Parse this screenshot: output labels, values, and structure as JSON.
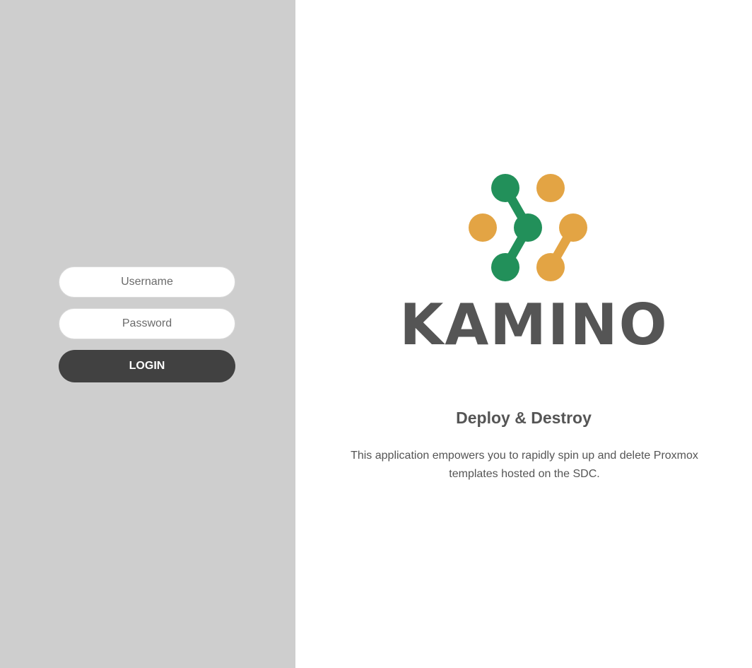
{
  "login": {
    "username_placeholder": "Username",
    "password_placeholder": "Password",
    "login_label": "LOGIN"
  },
  "brand": {
    "logo_icon": "molecule-network-icon",
    "name": "KAMINO",
    "tagline": "Deploy & Destroy",
    "description": "This application empowers you to rapidly spin up and delete Proxmox templates hosted on the SDC."
  },
  "colors": {
    "left_panel_bg": "#cecece",
    "button_bg": "#414141",
    "logo_green": "#22905a",
    "logo_orange": "#e3a444",
    "text_dark": "#555555"
  }
}
